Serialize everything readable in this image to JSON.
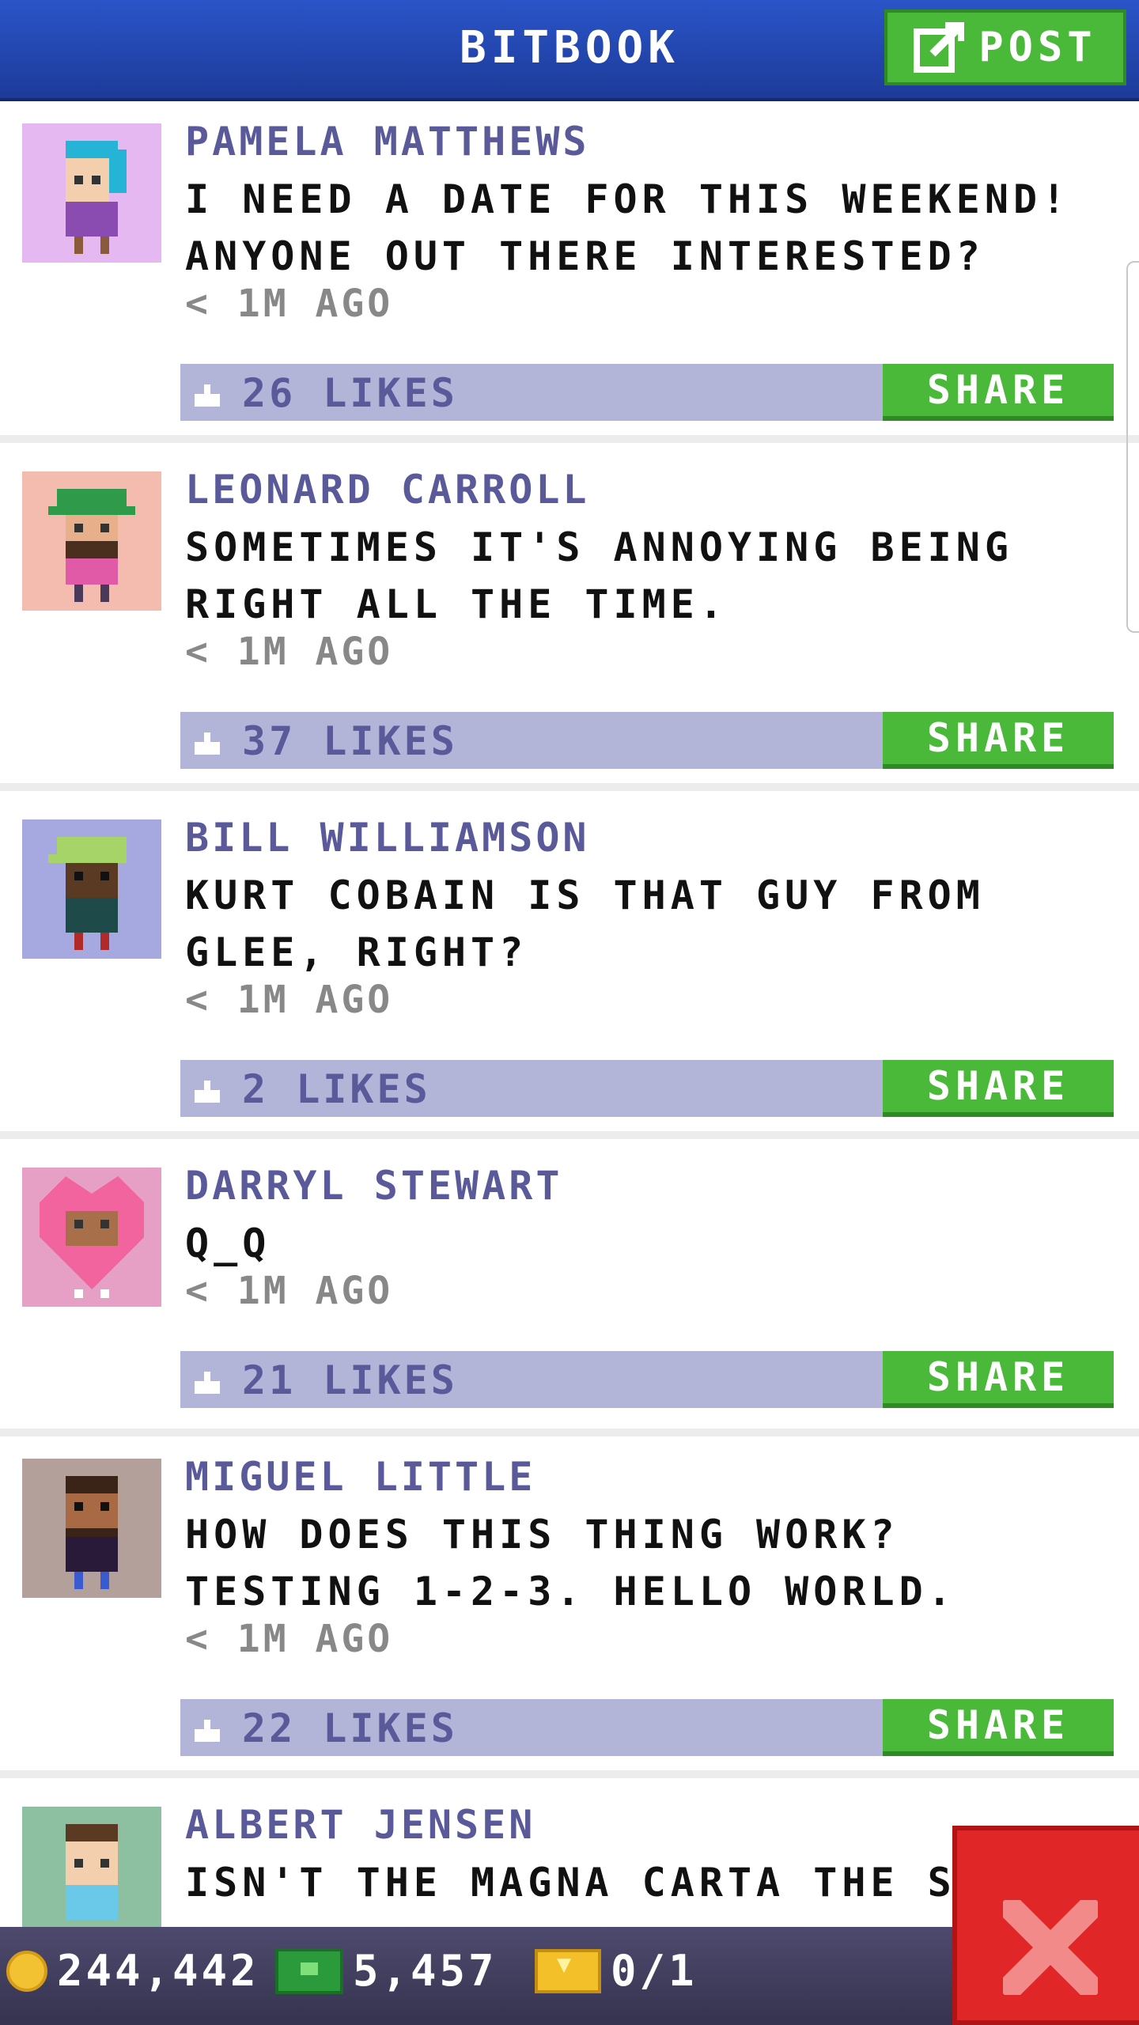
{
  "header": {
    "title": "BITBOOK",
    "post_label": "POST"
  },
  "posts": [
    {
      "name": "PAMELA MATTHEWS",
      "text": "I NEED A DATE FOR THIS WEEKEND! ANYONE OUT THERE INTERESTED?",
      "time": "< 1M AGO",
      "likes": "26 LIKES",
      "share": "SHARE"
    },
    {
      "name": "LEONARD CARROLL",
      "text": "SOMETIMES IT'S ANNOYING BEING RIGHT ALL THE TIME.",
      "time": "< 1M AGO",
      "likes": "37 LIKES",
      "share": "SHARE"
    },
    {
      "name": "BILL WILLIAMSON",
      "text": "KURT COBAIN IS THAT GUY FROM GLEE, RIGHT?",
      "time": "< 1M AGO",
      "likes": "2 LIKES",
      "share": "SHARE"
    },
    {
      "name": "DARRYL STEWART",
      "text": "Q_Q",
      "time": "< 1M AGO",
      "likes": "21 LIKES",
      "share": "SHARE"
    },
    {
      "name": "MIGUEL LITTLE",
      "text": "HOW DOES THIS THING WORK? TESTING 1-2-3. HELLO WORLD.",
      "time": "< 1M AGO",
      "likes": "22 LIKES",
      "share": "SHARE"
    },
    {
      "name": "ALBERT JENSEN",
      "text": "ISN'T THE MAGNA CARTA THE SH",
      "time": "",
      "likes": "",
      "share": ""
    }
  ],
  "status": {
    "coins": "244,442",
    "bux": "5,457",
    "tickets": "0/1"
  },
  "colors": {
    "header": "#1d3a99",
    "share_green": "#4ab838",
    "like_bar": "#b3b5d8",
    "name_purple": "#5a5a9a",
    "close_red": "#e02626"
  }
}
